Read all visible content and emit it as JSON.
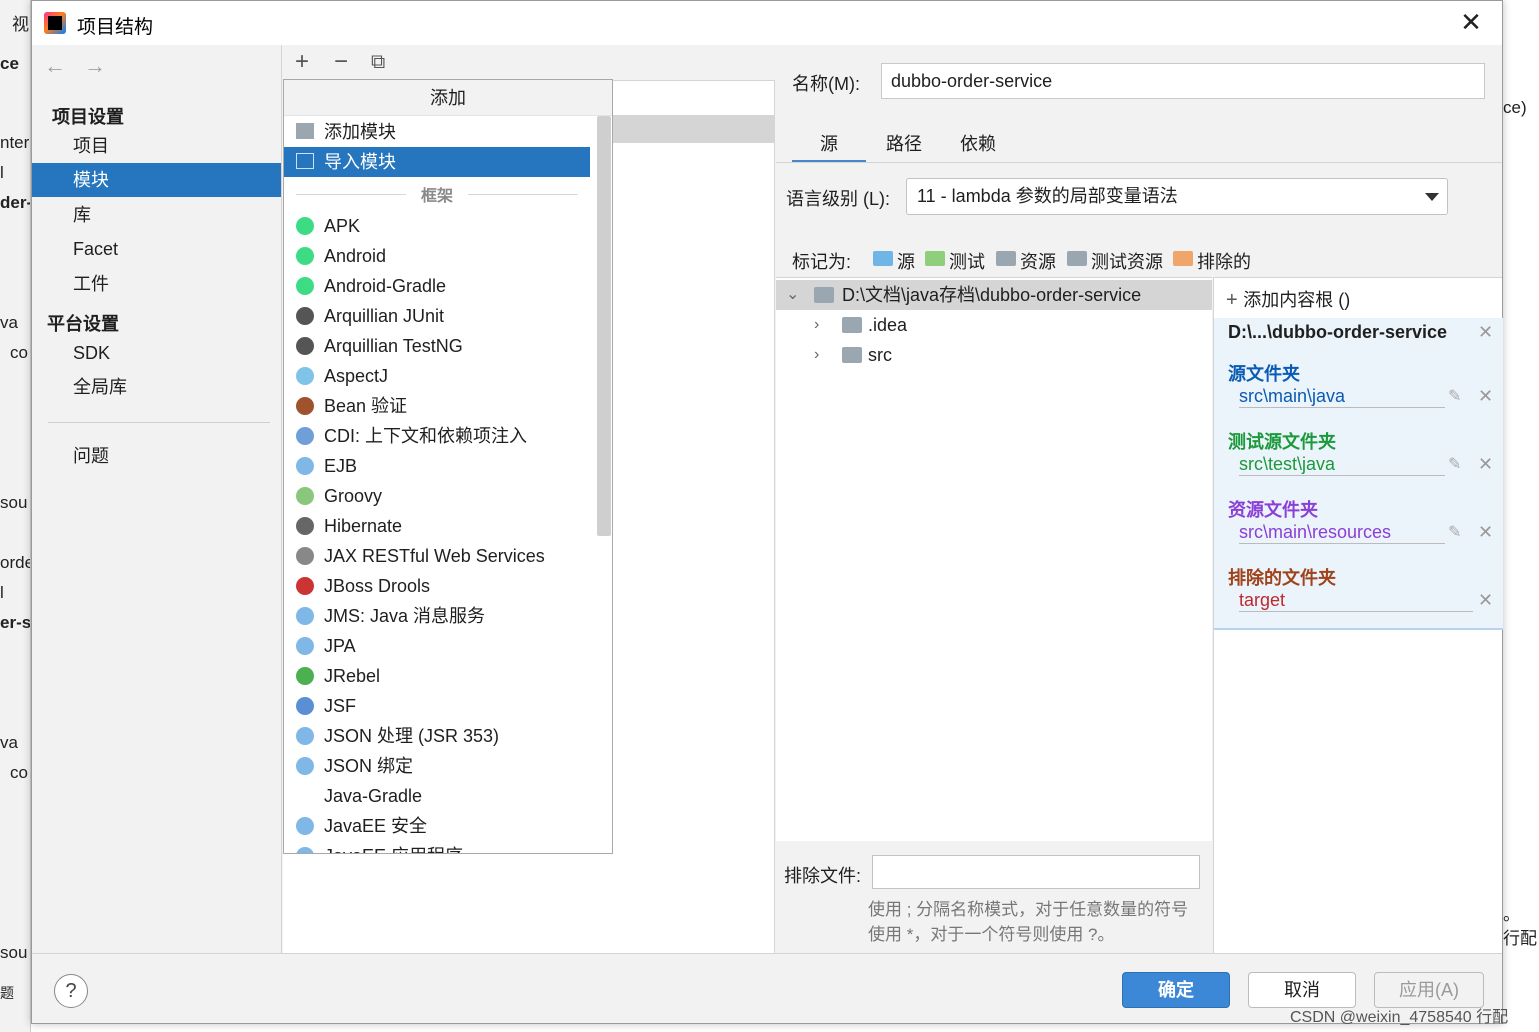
{
  "background": {
    "left_fragments": [
      "视",
      "ce",
      "nter",
      "l",
      "der-s",
      "va",
      "co",
      "sou",
      "orde",
      "l",
      "er-se",
      "va",
      "co",
      "sou",
      "题"
    ],
    "right_fragments": [
      "ce)",
      "。",
      "行配"
    ],
    "watermark": "CSDN @weixin_4758540 行配"
  },
  "dialog": {
    "title": "项目结构",
    "close": "✕"
  },
  "nav": {
    "back": "←",
    "forward": "→",
    "project_settings": "项目设置",
    "items1": [
      "项目",
      "模块",
      "库",
      "Facet",
      "工件"
    ],
    "platform_settings": "平台设置",
    "items2": [
      "SDK",
      "全局库"
    ],
    "problems": "问题",
    "selected": "模块"
  },
  "middle_toolbar": {
    "add": "+",
    "remove": "−",
    "copy": "⧉"
  },
  "popup": {
    "title": "添加",
    "add_module": "添加模块",
    "import_module": "导入模块",
    "framework_header": "框架",
    "frameworks": [
      "APK",
      "Android",
      "Android-Gradle",
      "Arquillian JUnit",
      "Arquillian TestNG",
      "AspectJ",
      "Bean 验证",
      "CDI: 上下文和依赖项注入",
      "EJB",
      "Groovy",
      "Hibernate",
      "JAX RESTful Web Services",
      "JBoss Drools",
      "JMS: Java 消息服务",
      "JPA",
      "JRebel",
      "JSF",
      "JSON 处理 (JSR 353)",
      "JSON 绑定",
      "Java-Gradle",
      "JavaEE 安全",
      "JavaEE 应用程序"
    ]
  },
  "right": {
    "name_label": "名称(M):",
    "name_value": "dubbo-order-service",
    "tabs": [
      "源",
      "路径",
      "依赖"
    ],
    "lang_label": "语言级别 (L):",
    "lang_value": "11 - lambda 参数的局部变量语法",
    "mark_label": "标记为:",
    "marks": [
      "源",
      "测试",
      "资源",
      "测试资源",
      "排除的"
    ],
    "mark_colors": [
      "#6fb5e6",
      "#8fce7a",
      "#9aa7b0",
      "#9aa7b0",
      "#f0a56a"
    ],
    "tree_root": "D:\\文档\\java存档\\dubbo-order-service",
    "tree_children": [
      ".idea",
      "src"
    ],
    "exclude_label": "排除文件:",
    "hint": "使用 ; 分隔名称模式，对于任意数量的符号使用 *，对于一个符号则使用 ?。"
  },
  "roots": {
    "add_label": "添加内容根 ()",
    "root": "D:\\...\\dubbo-order-service",
    "source_header": "源文件夹",
    "source_path": "src\\main\\java",
    "test_header": "测试源文件夹",
    "test_path": "src\\test\\java",
    "resource_header": "资源文件夹",
    "resource_path": "src\\main\\resources",
    "excluded_header": "排除的文件夹",
    "excluded_path": "target",
    "colors": {
      "source": "#0a5bb4",
      "test": "#1b9a3c",
      "resource": "#8a3fd6",
      "excluded": "#a0421a",
      "excluded_path": "#c0282d"
    }
  },
  "footer": {
    "help": "?",
    "ok": "确定",
    "cancel": "取消",
    "apply": "应用(A)"
  }
}
